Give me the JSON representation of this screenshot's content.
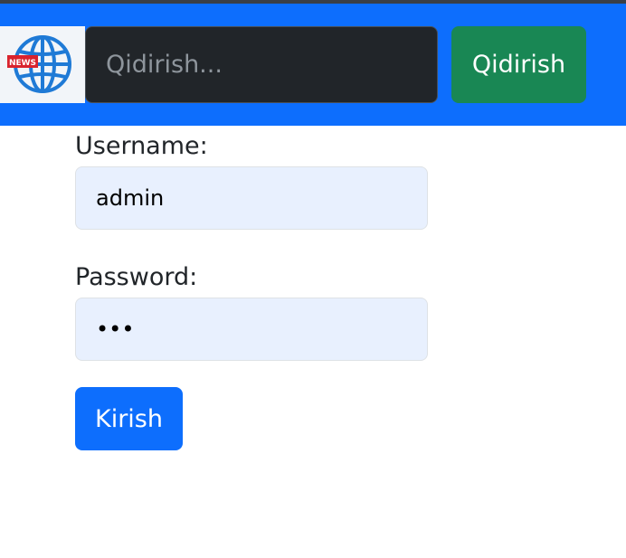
{
  "header": {
    "logo_text": "NEWS",
    "search_placeholder": "Qidirish...",
    "search_button_label": "Qidirish"
  },
  "login_form": {
    "username_label": "Username:",
    "username_value": "admin",
    "password_label": "Password:",
    "password_value": "abc",
    "submit_label": "Kirish"
  },
  "colors": {
    "navbar": "#0d6efd",
    "search_button": "#198754",
    "login_button": "#0d6efd",
    "input_autofill": "#e8f0fe"
  }
}
